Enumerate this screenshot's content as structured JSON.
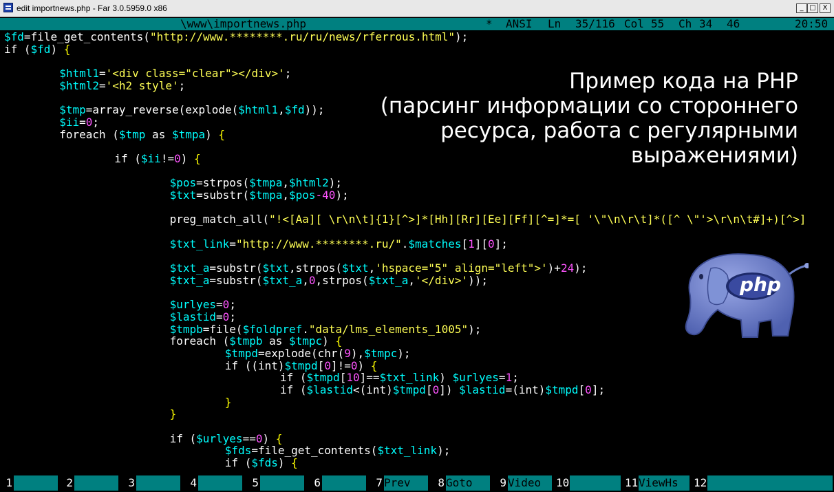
{
  "window": {
    "title": "edit importnews.php - Far 3.0.5959.0 x86",
    "buttons": {
      "minimize": "_",
      "maximize": "□",
      "close": "X"
    }
  },
  "status": {
    "file": "\\www\\importnews.php",
    "modified": "*",
    "encoding": "ANSI",
    "line_label": "Ln",
    "line_value": "35/116",
    "col_label": "Col",
    "col_value": "55",
    "char_label": "Ch",
    "char_value": "34",
    "char_code": "46",
    "clock": "20:50"
  },
  "caption": {
    "lines": [
      "Пример кода на PHP",
      "(парсинг информации со стороннего",
      "ресурса, работа с регулярными",
      "выражениями)"
    ]
  },
  "logo": {
    "text": "php",
    "color": "#6b7fc4"
  },
  "colors": {
    "background": "#000000",
    "panel": "#008080",
    "variable": "#00ffff",
    "string": "#ffff55",
    "number": "#ff55ff",
    "plain": "#ffffff"
  },
  "code_lines": [
    {
      "indent": 0,
      "tokens": [
        {
          "t": "var",
          "s": "$fd"
        },
        {
          "t": "default",
          "s": "=file_get_contents("
        },
        {
          "t": "str",
          "s": "\"http://www.********.ru/ru/news/rferrous.html\""
        },
        {
          "t": "default",
          "s": ");"
        }
      ]
    },
    {
      "indent": 0,
      "tokens": [
        {
          "t": "default",
          "s": "if ("
        },
        {
          "t": "var",
          "s": "$fd"
        },
        {
          "t": "default",
          "s": ") "
        },
        {
          "t": "brace",
          "s": "{"
        }
      ]
    },
    {
      "indent": 0,
      "tokens": []
    },
    {
      "indent": 1,
      "tokens": [
        {
          "t": "var",
          "s": "$html1"
        },
        {
          "t": "default",
          "s": "="
        },
        {
          "t": "str",
          "s": "'<div class=\"clear\"></div>'"
        },
        {
          "t": "default",
          "s": ";"
        }
      ]
    },
    {
      "indent": 1,
      "tokens": [
        {
          "t": "var",
          "s": "$html2"
        },
        {
          "t": "default",
          "s": "="
        },
        {
          "t": "str",
          "s": "'<h2 style'"
        },
        {
          "t": "default",
          "s": ";"
        }
      ]
    },
    {
      "indent": 0,
      "tokens": []
    },
    {
      "indent": 1,
      "tokens": [
        {
          "t": "var",
          "s": "$tmp"
        },
        {
          "t": "default",
          "s": "=array_reverse(explode("
        },
        {
          "t": "var",
          "s": "$html1"
        },
        {
          "t": "default",
          "s": ","
        },
        {
          "t": "var",
          "s": "$fd"
        },
        {
          "t": "default",
          "s": "));"
        }
      ]
    },
    {
      "indent": 1,
      "tokens": [
        {
          "t": "var",
          "s": "$ii"
        },
        {
          "t": "default",
          "s": "="
        },
        {
          "t": "num",
          "s": "0"
        },
        {
          "t": "default",
          "s": ";"
        }
      ]
    },
    {
      "indent": 1,
      "tokens": [
        {
          "t": "default",
          "s": "foreach ("
        },
        {
          "t": "var",
          "s": "$tmp"
        },
        {
          "t": "default",
          "s": " as "
        },
        {
          "t": "var",
          "s": "$tmpa"
        },
        {
          "t": "default",
          "s": ") "
        },
        {
          "t": "brace",
          "s": "{"
        }
      ]
    },
    {
      "indent": 0,
      "tokens": []
    },
    {
      "indent": 2,
      "tokens": [
        {
          "t": "default",
          "s": "if ("
        },
        {
          "t": "var",
          "s": "$ii"
        },
        {
          "t": "default",
          "s": "!="
        },
        {
          "t": "num",
          "s": "0"
        },
        {
          "t": "default",
          "s": ") "
        },
        {
          "t": "brace",
          "s": "{"
        }
      ]
    },
    {
      "indent": 0,
      "tokens": []
    },
    {
      "indent": 3,
      "tokens": [
        {
          "t": "var",
          "s": "$pos"
        },
        {
          "t": "default",
          "s": "=strpos("
        },
        {
          "t": "var",
          "s": "$tmpa"
        },
        {
          "t": "default",
          "s": ","
        },
        {
          "t": "var",
          "s": "$html2"
        },
        {
          "t": "default",
          "s": ");"
        }
      ]
    },
    {
      "indent": 3,
      "tokens": [
        {
          "t": "var",
          "s": "$txt"
        },
        {
          "t": "default",
          "s": "=substr("
        },
        {
          "t": "var",
          "s": "$tmpa"
        },
        {
          "t": "default",
          "s": ","
        },
        {
          "t": "var",
          "s": "$pos"
        },
        {
          "t": "num",
          "s": "-40"
        },
        {
          "t": "default",
          "s": ");"
        }
      ]
    },
    {
      "indent": 0,
      "tokens": []
    },
    {
      "indent": 3,
      "tokens": [
        {
          "t": "default",
          "s": "preg_match_all("
        },
        {
          "t": "str",
          "s": "\"!<[Aa][ \\r\\n\\t]{1}[^>]*[Hh][Rr][Ee][Ff][^=]*=[ '\\\"\\n\\r\\t]*([^ \\\"'>\\r\\n\\t#]+)[^>]"
        }
      ]
    },
    {
      "indent": 0,
      "tokens": []
    },
    {
      "indent": 3,
      "tokens": [
        {
          "t": "var",
          "s": "$txt_link"
        },
        {
          "t": "default",
          "s": "="
        },
        {
          "t": "str",
          "s": "\"http://www.********.ru/\""
        },
        {
          "t": "default",
          "s": "."
        },
        {
          "t": "var",
          "s": "$matches"
        },
        {
          "t": "default",
          "s": "["
        },
        {
          "t": "num",
          "s": "1"
        },
        {
          "t": "default",
          "s": "]["
        },
        {
          "t": "num",
          "s": "0"
        },
        {
          "t": "default",
          "s": "];"
        }
      ]
    },
    {
      "indent": 0,
      "tokens": []
    },
    {
      "indent": 3,
      "tokens": [
        {
          "t": "var",
          "s": "$txt_a"
        },
        {
          "t": "default",
          "s": "=substr("
        },
        {
          "t": "var",
          "s": "$txt"
        },
        {
          "t": "default",
          "s": ",strpos("
        },
        {
          "t": "var",
          "s": "$txt"
        },
        {
          "t": "default",
          "s": ","
        },
        {
          "t": "str",
          "s": "'hspace=\"5\" align=\"left\">'"
        },
        {
          "t": "default",
          "s": ")+"
        },
        {
          "t": "num",
          "s": "24"
        },
        {
          "t": "default",
          "s": ");"
        }
      ]
    },
    {
      "indent": 3,
      "tokens": [
        {
          "t": "var",
          "s": "$txt_a"
        },
        {
          "t": "default",
          "s": "=substr("
        },
        {
          "t": "var",
          "s": "$txt_a"
        },
        {
          "t": "default",
          "s": ","
        },
        {
          "t": "num",
          "s": "0"
        },
        {
          "t": "default",
          "s": ",strpos("
        },
        {
          "t": "var",
          "s": "$txt_a"
        },
        {
          "t": "default",
          "s": ","
        },
        {
          "t": "str",
          "s": "'</div>'"
        },
        {
          "t": "default",
          "s": "));"
        }
      ]
    },
    {
      "indent": 0,
      "tokens": []
    },
    {
      "indent": 3,
      "tokens": [
        {
          "t": "var",
          "s": "$urlyes"
        },
        {
          "t": "default",
          "s": "="
        },
        {
          "t": "num",
          "s": "0"
        },
        {
          "t": "default",
          "s": ";"
        }
      ]
    },
    {
      "indent": 3,
      "tokens": [
        {
          "t": "var",
          "s": "$lastid"
        },
        {
          "t": "default",
          "s": "="
        },
        {
          "t": "num",
          "s": "0"
        },
        {
          "t": "default",
          "s": ";"
        }
      ]
    },
    {
      "indent": 3,
      "tokens": [
        {
          "t": "var",
          "s": "$tmpb"
        },
        {
          "t": "default",
          "s": "=file("
        },
        {
          "t": "var",
          "s": "$foldpref"
        },
        {
          "t": "default",
          "s": "."
        },
        {
          "t": "str",
          "s": "\"data/lms_elements_1005\""
        },
        {
          "t": "default",
          "s": ");"
        }
      ]
    },
    {
      "indent": 3,
      "tokens": [
        {
          "t": "default",
          "s": "foreach ("
        },
        {
          "t": "var",
          "s": "$tmpb"
        },
        {
          "t": "default",
          "s": " as "
        },
        {
          "t": "var",
          "s": "$tmpc"
        },
        {
          "t": "default",
          "s": ") "
        },
        {
          "t": "brace",
          "s": "{"
        }
      ]
    },
    {
      "indent": 4,
      "tokens": [
        {
          "t": "var",
          "s": "$tmpd"
        },
        {
          "t": "default",
          "s": "=explode(chr("
        },
        {
          "t": "num",
          "s": "9"
        },
        {
          "t": "default",
          "s": "),"
        },
        {
          "t": "var",
          "s": "$tmpc"
        },
        {
          "t": "default",
          "s": ");"
        }
      ]
    },
    {
      "indent": 4,
      "tokens": [
        {
          "t": "default",
          "s": "if ((int)"
        },
        {
          "t": "var",
          "s": "$tmpd"
        },
        {
          "t": "default",
          "s": "["
        },
        {
          "t": "num",
          "s": "0"
        },
        {
          "t": "default",
          "s": "]!="
        },
        {
          "t": "num",
          "s": "0"
        },
        {
          "t": "default",
          "s": ") "
        },
        {
          "t": "brace",
          "s": "{"
        }
      ]
    },
    {
      "indent": 5,
      "tokens": [
        {
          "t": "default",
          "s": "if ("
        },
        {
          "t": "var",
          "s": "$tmpd"
        },
        {
          "t": "default",
          "s": "["
        },
        {
          "t": "num",
          "s": "10"
        },
        {
          "t": "default",
          "s": "]=="
        },
        {
          "t": "var",
          "s": "$txt_link"
        },
        {
          "t": "default",
          "s": ") "
        },
        {
          "t": "var",
          "s": "$urlyes"
        },
        {
          "t": "default",
          "s": "="
        },
        {
          "t": "num",
          "s": "1"
        },
        {
          "t": "default",
          "s": ";"
        }
      ]
    },
    {
      "indent": 5,
      "tokens": [
        {
          "t": "default",
          "s": "if ("
        },
        {
          "t": "var",
          "s": "$lastid"
        },
        {
          "t": "default",
          "s": "<(int)"
        },
        {
          "t": "var",
          "s": "$tmpd"
        },
        {
          "t": "default",
          "s": "["
        },
        {
          "t": "num",
          "s": "0"
        },
        {
          "t": "default",
          "s": "]) "
        },
        {
          "t": "var",
          "s": "$lastid"
        },
        {
          "t": "default",
          "s": "=(int)"
        },
        {
          "t": "var",
          "s": "$tmpd"
        },
        {
          "t": "default",
          "s": "["
        },
        {
          "t": "num",
          "s": "0"
        },
        {
          "t": "default",
          "s": "];"
        }
      ]
    },
    {
      "indent": 4,
      "tokens": [
        {
          "t": "brace",
          "s": "}"
        }
      ]
    },
    {
      "indent": 3,
      "tokens": [
        {
          "t": "brace",
          "s": "}"
        }
      ]
    },
    {
      "indent": 0,
      "tokens": []
    },
    {
      "indent": 3,
      "tokens": [
        {
          "t": "default",
          "s": "if ("
        },
        {
          "t": "var",
          "s": "$urlyes"
        },
        {
          "t": "default",
          "s": "=="
        },
        {
          "t": "num",
          "s": "0"
        },
        {
          "t": "default",
          "s": ") "
        },
        {
          "t": "brace",
          "s": "{"
        }
      ]
    },
    {
      "indent": 4,
      "tokens": [
        {
          "t": "var",
          "s": "$fds"
        },
        {
          "t": "default",
          "s": "=file_get_contents("
        },
        {
          "t": "var",
          "s": "$txt_link"
        },
        {
          "t": "default",
          "s": ");"
        }
      ]
    },
    {
      "indent": 4,
      "tokens": [
        {
          "t": "default",
          "s": "if ("
        },
        {
          "t": "var",
          "s": "$fds"
        },
        {
          "t": "default",
          "s": ") "
        },
        {
          "t": "brace",
          "s": "{"
        }
      ]
    }
  ],
  "fkeys": [
    {
      "num": "1",
      "label": ""
    },
    {
      "num": "2",
      "label": ""
    },
    {
      "num": "3",
      "label": ""
    },
    {
      "num": "4",
      "label": ""
    },
    {
      "num": "5",
      "label": ""
    },
    {
      "num": "6",
      "label": ""
    },
    {
      "num": "7",
      "label": "Prev"
    },
    {
      "num": "8",
      "label": "Goto"
    },
    {
      "num": "9",
      "label": "Video"
    },
    {
      "num": "10",
      "label": ""
    },
    {
      "num": "11",
      "label": "ViewHs"
    },
    {
      "num": "12",
      "label": ""
    }
  ]
}
